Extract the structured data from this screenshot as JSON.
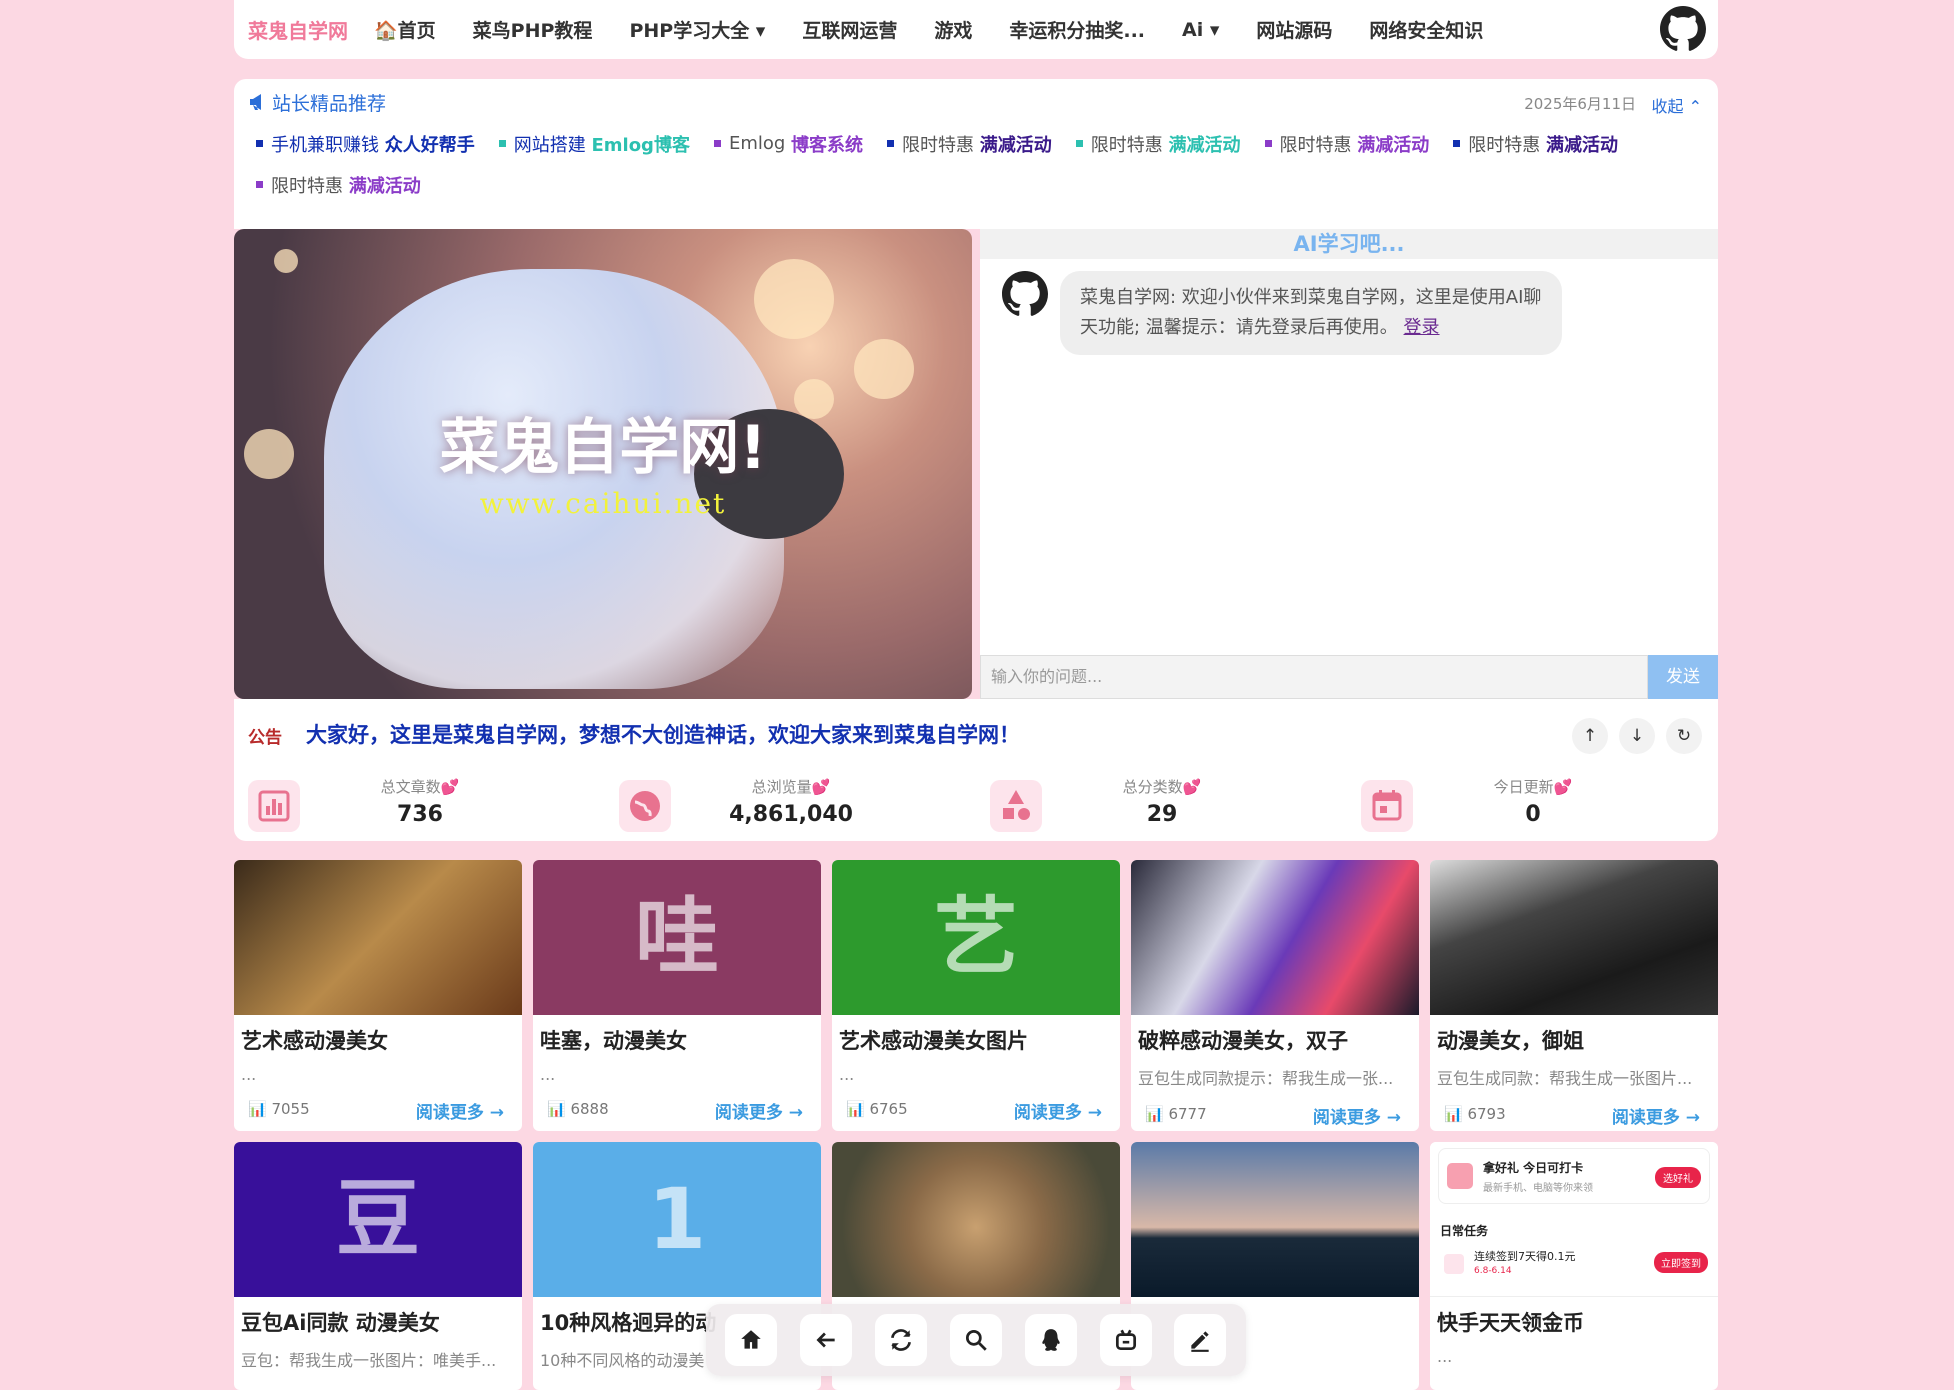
{
  "nav": {
    "brand": "菜鬼自学网",
    "items": [
      "🏠首页",
      "菜鸟PHP教程",
      "PHP学习大全 ▾",
      "互联网运营",
      "游戏",
      "幸运积分抽奖...",
      "Ai ▾",
      "网站源码",
      "网络安全知识"
    ]
  },
  "recommend": {
    "title": "站长精品推荐",
    "date": "2025年6月11日",
    "collapse_label": "收起 ⌃",
    "links": [
      {
        "a": "手机兼职赚钱",
        "b": "众人好帮手",
        "color": "#1230b0"
      },
      {
        "a": "网站搭建",
        "b": "Emlog博客",
        "color": "#2cc0b0"
      },
      {
        "a": "Emlog",
        "b": "博客系统",
        "color": "#8b3cc8"
      },
      {
        "a": "限时特惠",
        "b": "满减活动",
        "color": "#3a1a8a"
      },
      {
        "a": "限时特惠",
        "b": "满减活动",
        "color": "#2cc0b0"
      },
      {
        "a": "限时特惠",
        "b": "满减活动",
        "color": "#8b3cc8"
      },
      {
        "a": "限时特惠",
        "b": "满减活动",
        "color": "#3a1a8a"
      },
      {
        "a": "限时特惠",
        "b": "满减活动",
        "color": "#8b3cc8"
      }
    ]
  },
  "hero": {
    "title": "菜鬼自学网!",
    "url": "www.caihui.net"
  },
  "ai": {
    "header": "AI学习吧...",
    "message": "菜鬼自学网: 欢迎小伙伴来到菜鬼自学网，这里是使用AI聊天功能; 温馨提示：请先登录后再使用。",
    "login_link": "登录",
    "input_placeholder": "输入你的问题...",
    "send_label": "发送"
  },
  "notice": {
    "tag": "公告",
    "text": "大家好，这里是菜鬼自学网，梦想不大创造神话，欢迎大家来到菜鬼自学网！",
    "controls": [
      "↑",
      "↓",
      "↻"
    ]
  },
  "stats": [
    {
      "label": "总文章数💕",
      "value": "736"
    },
    {
      "label": "总浏览量💕",
      "value": "4,861,040"
    },
    {
      "label": "总分类数💕",
      "value": "29"
    },
    {
      "label": "今日更新💕",
      "value": "0"
    }
  ],
  "cards": [
    {
      "title": "艺术感动漫美女",
      "desc": "...",
      "views": "7055",
      "more": "阅读更多 →",
      "bg": "#8a5a2a",
      "glyph": ""
    },
    {
      "title": "哇塞，动漫美女",
      "desc": "...",
      "views": "6888",
      "more": "阅读更多 →",
      "bg": "#8a3a62",
      "glyph": "哇"
    },
    {
      "title": "艺术感动漫美女图片",
      "desc": "...",
      "views": "6765",
      "more": "阅读更多 →",
      "bg": "#2d9a2d",
      "glyph": "艺"
    },
    {
      "title": "破粹感动漫美女，双子",
      "desc": "豆包生成同款提示：帮我生成一张...",
      "views": "6777",
      "more": "阅读更多 →",
      "bg": "#6a5a9a",
      "glyph": ""
    },
    {
      "title": "动漫美女，御姐",
      "desc": "豆包生成同款：帮我生成一张图片...",
      "views": "6793",
      "more": "阅读更多 →",
      "bg": "#3a3a3a",
      "glyph": ""
    },
    {
      "title": "豆包Ai同款 动漫美女",
      "desc": "豆包：帮我生成一张图片：唯美手...",
      "views": "",
      "more": "",
      "bg": "#38109a",
      "glyph": "豆"
    },
    {
      "title": "10种风格迥异的动",
      "desc": "10种不同风格的动漫美",
      "views": "",
      "more": "",
      "bg": "#5aaee8",
      "glyph": "1"
    },
    {
      "title": "",
      "desc": "",
      "views": "",
      "more": "",
      "bg": "#6a5a48",
      "glyph": ""
    },
    {
      "title": "",
      "desc": "",
      "views": "",
      "more": "",
      "bg": "#1a2a4a",
      "glyph": ""
    },
    {
      "title": "快手天天领金币",
      "desc": "...",
      "views": "",
      "more": "",
      "bg": "#ffffff",
      "glyph": ""
    }
  ],
  "promo": {
    "headline": "拿好礼 今日可打卡",
    "sub": "最新手机、电脑等你来领",
    "badge": "选好礼",
    "section": "日常任务",
    "task": "连续签到7天得0.1元",
    "task_sub": "6.8-6.14",
    "task_btn": "立即签到"
  },
  "dock": [
    "home-icon",
    "back-icon",
    "refresh-icon",
    "search-icon",
    "qq-icon",
    "robot-icon",
    "edit-icon"
  ]
}
